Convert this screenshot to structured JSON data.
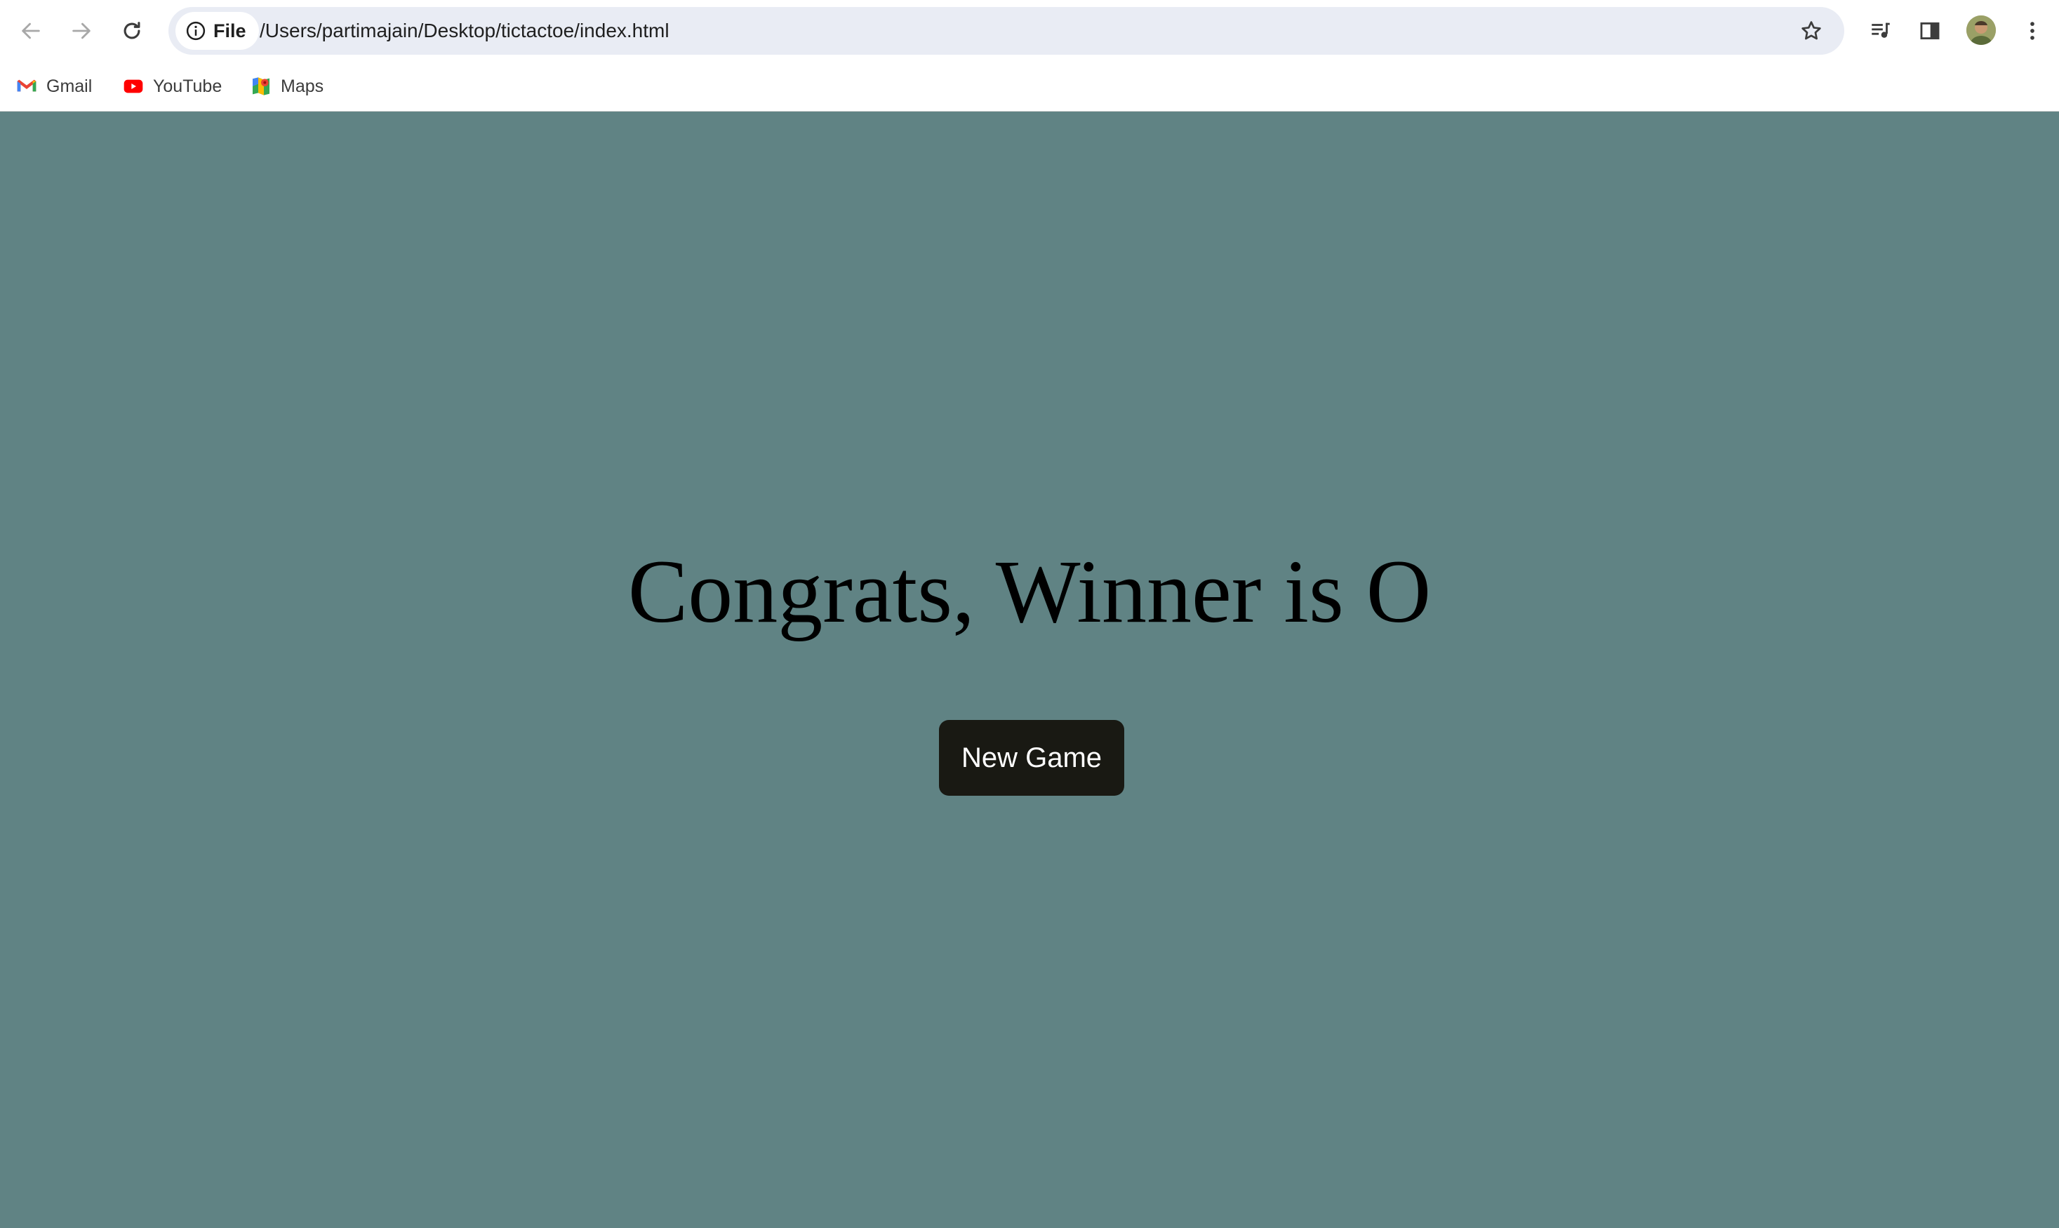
{
  "toolbar": {
    "back_icon": "arrow-left-icon",
    "forward_icon": "arrow-right-icon",
    "reload_icon": "reload-icon",
    "site_info_label": "File",
    "url": "/Users/partimajain/Desktop/tictactoe/index.html",
    "bookmark_star_icon": "star-icon",
    "media_icon": "media-queue-icon",
    "side_panel_icon": "side-panel-icon",
    "menu_icon": "kebab-menu-icon"
  },
  "bookmarks": [
    {
      "label": "Gmail",
      "icon": "gmail-icon"
    },
    {
      "label": "YouTube",
      "icon": "youtube-icon"
    },
    {
      "label": "Maps",
      "icon": "maps-icon"
    }
  ],
  "page": {
    "background_color": "#608384",
    "message": "Congrats, Winner is O",
    "new_game_label": "New Game",
    "button_color": "#191913"
  }
}
